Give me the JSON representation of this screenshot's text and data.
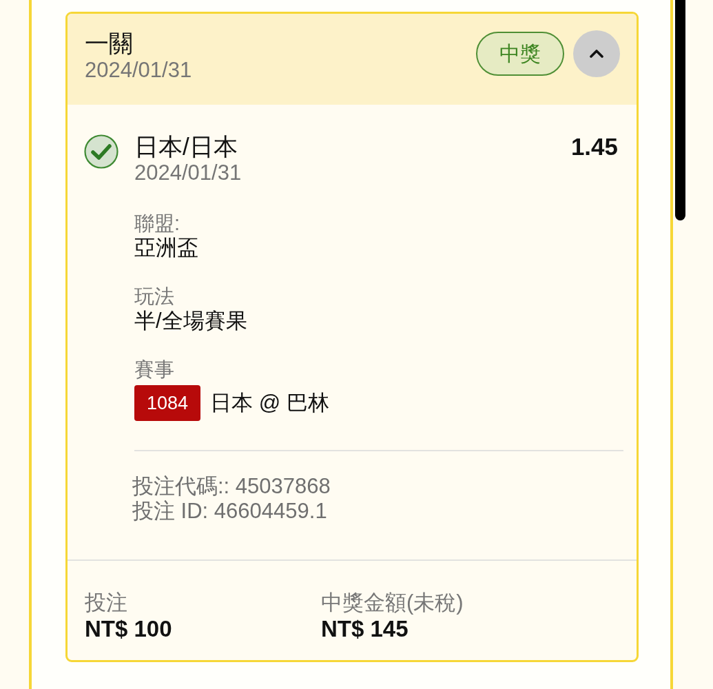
{
  "bet": {
    "type_label": "一關",
    "date": "2024/01/31",
    "status_badge": "中獎",
    "expanded": true,
    "legs": [
      {
        "selection": "日本/日本",
        "date": "2024/01/31",
        "odds": "1.45",
        "won": true,
        "fields": [
          {
            "label": "聯盟:",
            "value": "亞洲盃"
          },
          {
            "label": "玩法",
            "value": "半/全場賽果"
          }
        ],
        "match": {
          "label": "賽事",
          "code": "1084",
          "name": "日本 @ 巴林"
        }
      }
    ],
    "codes": [
      "投注代碼:: 45037868",
      "投注 ID: 46604459.1"
    ],
    "totals": [
      {
        "label": "投注",
        "value": "NT$ 100"
      },
      {
        "label": "中獎金額(未稅)",
        "value": "NT$ 145"
      }
    ]
  }
}
